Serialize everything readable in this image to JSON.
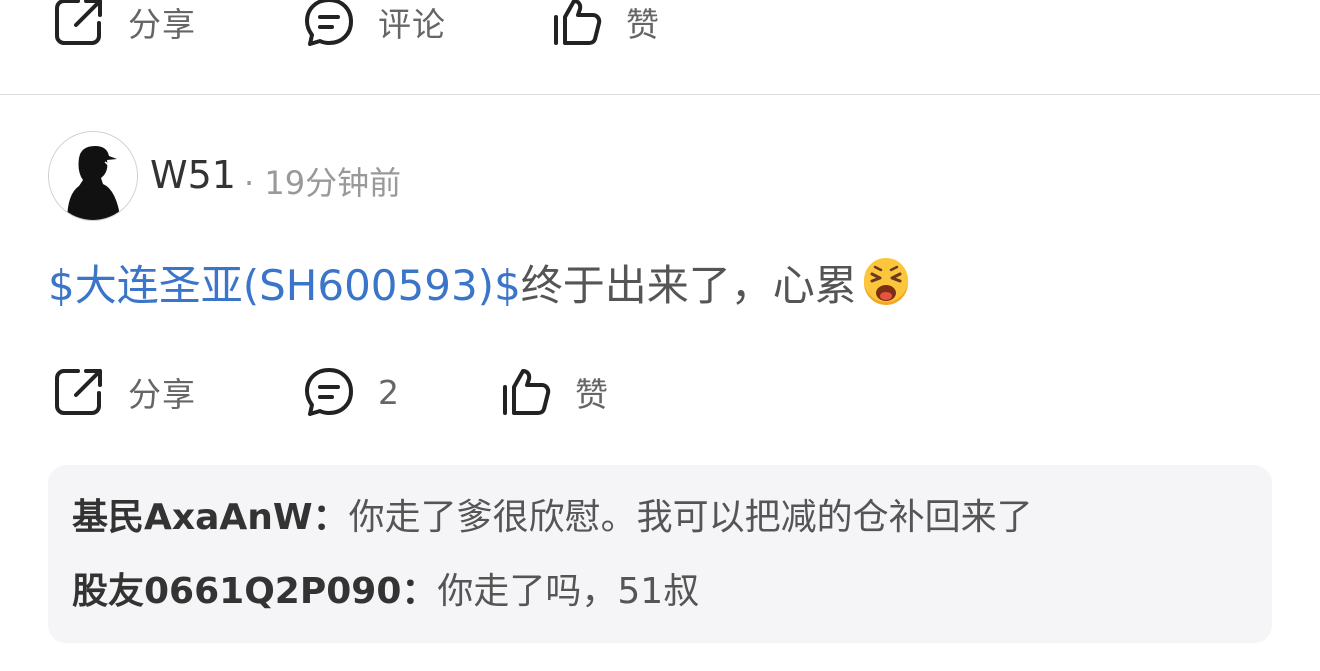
{
  "top_actions": {
    "share_label": "分享",
    "comment_label": "评论",
    "like_label": "赞"
  },
  "post": {
    "username": "W51",
    "timestamp": "· 19分钟前",
    "stock_link": "$大连圣亚(SH600593)$",
    "text": "终于出来了，心累",
    "emoji": "tired-face-emoji",
    "actions": {
      "share_label": "分享",
      "comment_count": "2",
      "like_label": "赞"
    }
  },
  "comments": [
    {
      "author": "基民AxaAnW：",
      "text": "你走了爹很欣慰。我可以把减的仓补回来了"
    },
    {
      "author": "股友0661Q2P090：",
      "text": "你走了吗，51叔"
    }
  ],
  "colors": {
    "link": "#3b75c9",
    "icon": "#222222",
    "muted_text": "#999999",
    "comment_box_bg": "#f5f5f7",
    "emoji_face": "#f5a623"
  }
}
